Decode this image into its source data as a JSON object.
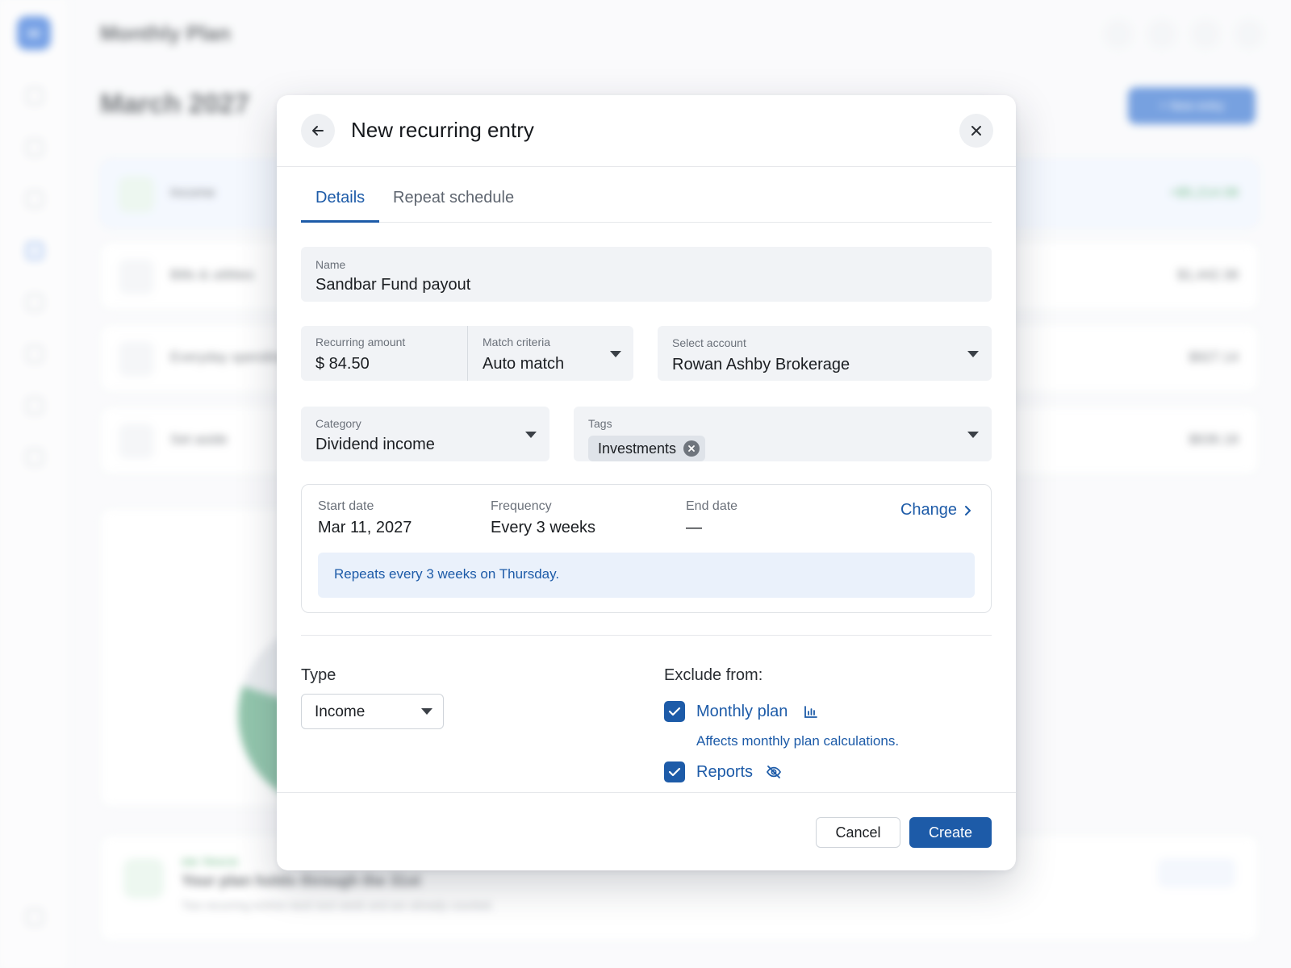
{
  "background": {
    "app_title": "Monthly Plan",
    "page_title": "March 2027",
    "new_entry_label": "+ New entry",
    "rows": [
      {
        "label": "Income",
        "amount": "+$5,214.08"
      },
      {
        "label": "Bills & utilities",
        "amount": "$1,442.38"
      },
      {
        "label": "Everyday spending",
        "amount": "$927.14"
      },
      {
        "label": "Set aside",
        "amount": "$636.18"
      }
    ],
    "bottom_card": {
      "kicker": "ON TRACK",
      "title": "Your plan holds through the 31st",
      "subtitle": "Two recurring entries land next week and are already counted."
    }
  },
  "modal": {
    "title": "New recurring entry",
    "tabs": [
      {
        "label": "Details",
        "active": true
      },
      {
        "label": "Repeat schedule",
        "active": false
      }
    ],
    "name": {
      "label": "Name",
      "value": "Sandbar Fund payout"
    },
    "amount": {
      "label": "Recurring amount",
      "value": "$ 84.50"
    },
    "match": {
      "label": "Match criteria",
      "value": "Auto match"
    },
    "account": {
      "label": "Select account",
      "value": "Rowan Ashby Brokerage"
    },
    "category": {
      "label": "Category",
      "value": "Dividend income"
    },
    "tags": {
      "label": "Tags",
      "items": [
        "Investments"
      ]
    },
    "schedule": {
      "start_label": "Start date",
      "start_value": "Mar 11, 2027",
      "frequency_label": "Frequency",
      "frequency_value": "Every 3 weeks",
      "end_label": "End date",
      "end_value": "—",
      "change_label": "Change",
      "note": "Repeats every 3 weeks on Thursday."
    },
    "type": {
      "label": "Type",
      "value": "Income"
    },
    "exclude": {
      "label": "Exclude from:",
      "monthly_plan": {
        "label": "Monthly plan",
        "checked": true,
        "help": "Affects monthly plan calculations."
      },
      "reports": {
        "label": "Reports",
        "checked": true
      }
    },
    "cancel_label": "Cancel",
    "create_label": "Create"
  },
  "colors": {
    "accent": "#1d5ba8",
    "field_bg": "#f1f3f6",
    "note_bg": "#eaf1fb"
  },
  "icons": [
    "back-arrow-icon",
    "close-icon",
    "caret-down-icon",
    "chip-remove-icon",
    "chevron-right-icon",
    "checkmark-icon",
    "bar-chart-icon",
    "eye-off-icon"
  ]
}
